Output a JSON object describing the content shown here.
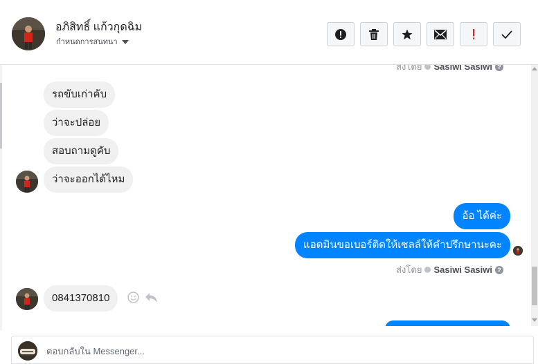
{
  "header": {
    "contact_name": "อภิสิทธิ์ แก้วกุดฉิม",
    "settings_label": "กำหนดการสนทนา",
    "actions": [
      "mark-spam",
      "delete",
      "star",
      "email",
      "important",
      "done"
    ]
  },
  "messages": {
    "top_sent_by_prefix": "ส่งโดย",
    "top_sent_by_name": "Sasiwi Sasiwi",
    "incoming": [
      "รถขับเก่าคับ",
      "ว่าจะปล่อย",
      "สอบถามดูคับ",
      "ว่าจะออกได้ไหม"
    ],
    "outgoing": [
      "อ้อ ได้ค่ะ",
      "แอดมินขอเบอร์ติดให้เซลล์ให้คำปรึกษานะคะ"
    ],
    "sent_by_prefix": "ส่งโดย",
    "sent_by_name": "Sasiwi Sasiwi",
    "help_glyph": "?",
    "phone_message": "0841370810"
  },
  "composer": {
    "placeholder": "ตอบกลับใน Messenger..."
  },
  "colors": {
    "outgoing_bubble": "#0084ff",
    "incoming_bubble": "#f1f0f0",
    "important": "#e02020"
  },
  "icons": {
    "spam": "exclamation-circle-icon",
    "delete": "trash-icon",
    "star": "star-icon",
    "email": "envelope-icon",
    "important": "exclamation-icon",
    "done": "check-icon",
    "emoji": "smiley-icon",
    "reply": "reply-icon"
  }
}
